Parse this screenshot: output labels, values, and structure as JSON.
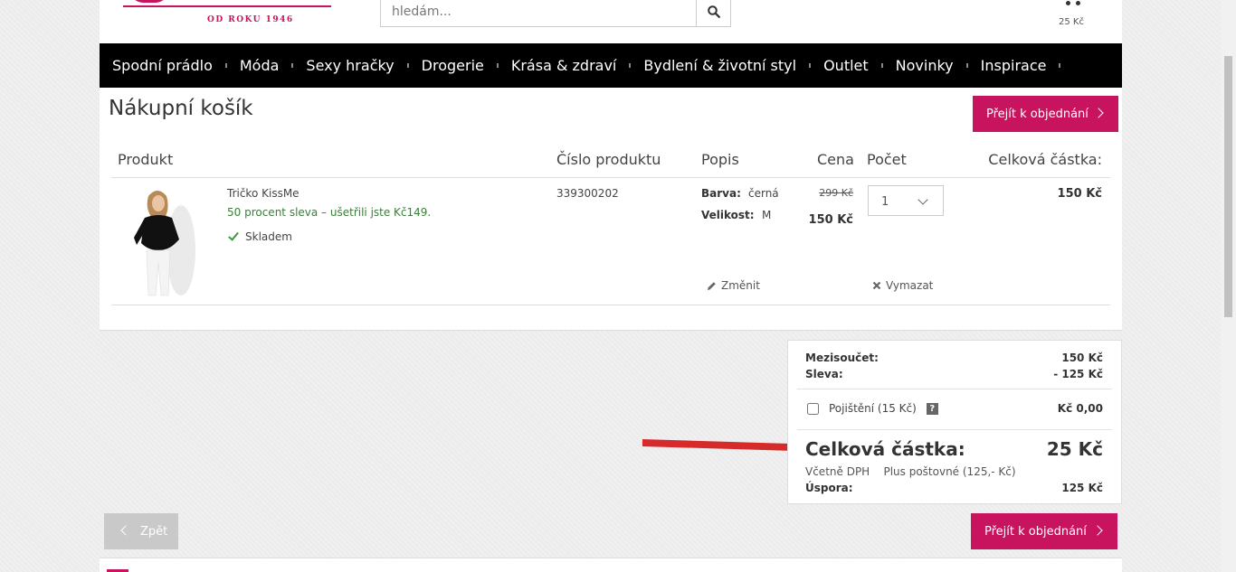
{
  "header": {
    "logo_tagline": "OD ROKU 1946",
    "search_placeholder": "hledám...",
    "cart_total": "25 Kč"
  },
  "nav": {
    "items": [
      "Spodní prádlo",
      "Móda",
      "Sexy hračky",
      "Drogerie",
      "Krása & zdraví",
      "Bydlení & životní styl",
      "Outlet",
      "Novinky",
      "Inspirace"
    ]
  },
  "cart": {
    "title": "Nákupní košík",
    "order_button": "Přejít k objednání",
    "columns": {
      "product": "Produkt",
      "number": "Číslo produktu",
      "description": "Popis",
      "price": "Cena",
      "quantity": "Počet",
      "total": "Celková částka:"
    },
    "item": {
      "name": "Tričko KissMe",
      "sale_text": "50 procent sleva – ušetřili jste Kč149.",
      "stock": "Skladem",
      "product_number": "339300202",
      "color_label": "Barva:",
      "color_value": "černá",
      "size_label": "Velikost:",
      "size_value": "M",
      "price_old": "299 Kč",
      "price_new": "150 Kč",
      "quantity": "1",
      "line_total": "150 Kč",
      "edit_label": "Změnit",
      "delete_label": "Vymazat"
    }
  },
  "summary": {
    "subtotal_label": "Mezisoučet:",
    "subtotal_value": "150 Kč",
    "discount_label": "Sleva:",
    "discount_value": "- 125 Kč",
    "insurance_label": "Pojištění (15 Kč)",
    "insurance_help": "?",
    "insurance_value": "Kč 0,00",
    "total_label": "Celková částka:",
    "total_value": "25 Kč",
    "vat_note": "Včetně DPH",
    "shipping_note": "Plus poštovné (125,- Kč)",
    "savings_label": "Úspora:",
    "savings_value": "125 Kč"
  },
  "footer_actions": {
    "back_label": "Zpět",
    "order_button": "Přejít k objednání"
  },
  "colors": {
    "brand": "#c8145e",
    "nav_bg": "#000000",
    "sale_green": "#3a7d3a",
    "arrow_red": "#d62b2b"
  }
}
